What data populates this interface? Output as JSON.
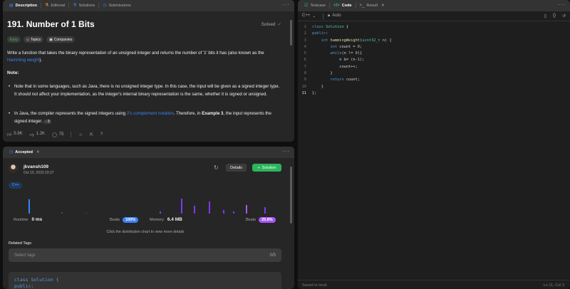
{
  "desc_tabs": [
    {
      "icon": "document-icon",
      "label": "Description",
      "active": true
    },
    {
      "icon": "flask-icon",
      "label": "Editorial",
      "active": false
    },
    {
      "icon": "beaker-icon",
      "label": "Solutions",
      "active": false
    },
    {
      "icon": "clock-icon",
      "label": "Submissions",
      "active": false
    }
  ],
  "problem": {
    "title": "191. Number of 1 Bits",
    "status": "Solved",
    "tags": {
      "difficulty": "Easy",
      "topics": "Topics",
      "companies": "Companies"
    },
    "intro": "Write a function that takes the binary representation of an unsigned integer and returns the number of '1' bits it has (also known as the ",
    "intro_link": "Hamming weight",
    "intro_end": ").",
    "note_heading": "Note:",
    "bullet1": "Note that in some languages, such as Java, there is no unsigned integer type. In this case, the input will be given as a signed integer type. It should not affect your implementation, as the integer's internal binary representation is the same, whether it is signed or unsigned.",
    "bullet2_a": "In Java, the compiler represents the signed integers using ",
    "bullet2_link": "2's complement notation",
    "bullet2_b": ". Therefore, in ",
    "bullet2_bold": "Example 3",
    "bullet2_c": ", the input represents the signed integer. ",
    "bullet2_code": "-3"
  },
  "stats": {
    "likes": "5.9K",
    "dislikes": "1.2K",
    "comments": "75"
  },
  "accepted": {
    "tab_label": "Accepted",
    "username": "jkvansh109",
    "date": "Oct 15, 2023 23:27",
    "details_label": "Details",
    "solution_label": "Solution",
    "language": "C++",
    "runtime_label": "Runtime",
    "runtime_value": "0 ms",
    "beats_label": "Beats",
    "runtime_beats": "100%",
    "memory_label": "Memory",
    "memory_value": "6.4 MB",
    "memory_beats": "25.8%",
    "hint": "Click the distribution chart to view more details",
    "related_tags_label": "Related Tags",
    "tags_placeholder": "Select tags",
    "tags_count": "0/5",
    "code_preview_1": "class Solution {",
    "code_preview_2": "public:"
  },
  "editor": {
    "tabs": [
      {
        "icon": "checkbox-icon",
        "label": "Testcase",
        "active": false
      },
      {
        "icon": "code-icon",
        "label": "Code",
        "active": true
      },
      {
        "icon": "terminal-icon",
        "label": "Result",
        "active": false
      }
    ],
    "language": "C++",
    "auto_label": "Auto",
    "saved_label": "Saved to local",
    "cursor_pos": "Ln 11, Col 3"
  },
  "colors": {
    "accent_blue": "#3b82f6",
    "easy_green": "#2cbb5d",
    "solution_green": "#2db55d",
    "beats_purple": "#a855f7"
  }
}
